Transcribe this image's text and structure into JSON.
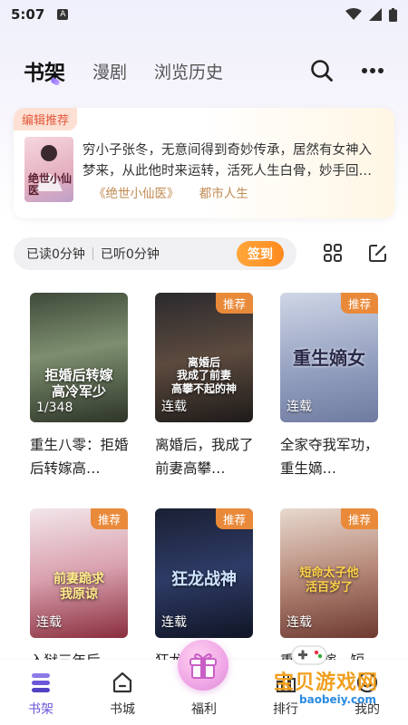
{
  "status": {
    "time": "5:07",
    "notification_icon": "A"
  },
  "header": {
    "tabs": [
      {
        "label": "书架",
        "active": true
      },
      {
        "label": "漫剧",
        "active": false
      },
      {
        "label": "浏览历史",
        "active": false
      }
    ]
  },
  "recommend": {
    "tag": "编辑推荐",
    "cover_text": "绝世小仙医",
    "line1": "穷小子张冬，无意间得到奇妙传承，居然有女神入",
    "line2": "梦来，从此他时来运转，活死人生白骨，妙手回…",
    "book": "《绝世小仙医》",
    "genre": "都市人生"
  },
  "read_bar": {
    "read": "已读0分钟",
    "listened": "已听0分钟",
    "sign": "签到"
  },
  "books": [
    {
      "title": "重生八零：拒婚后转嫁高…",
      "status": "1/348",
      "badge": "",
      "art": "拒婚后转嫁\n高冷军少"
    },
    {
      "title": "离婚后，我成了前妻高攀…",
      "status": "连载",
      "badge": "推荐",
      "art": "离婚后\n我成了前妻\n高攀不起的神"
    },
    {
      "title": "全家夺我军功，重生嫡…",
      "status": "连载",
      "badge": "推荐",
      "art": "重生嫡女"
    },
    {
      "title": "入狱三年后，…",
      "status": "连载",
      "badge": "推荐",
      "art": "前妻跪求\n我原谅"
    },
    {
      "title": "狂龙…",
      "status": "连载",
      "badge": "推荐",
      "art": "狂龙战神"
    },
    {
      "title": "重生…嫁…短",
      "status": "连载",
      "badge": "推荐",
      "art": "短命太子他\n活百岁了"
    }
  ],
  "nav": [
    {
      "label": "书架",
      "icon": "bookshelf-icon",
      "active": true
    },
    {
      "label": "书城",
      "icon": "store-icon",
      "active": false
    },
    {
      "label": "福利",
      "icon": "gift-icon",
      "active": false
    },
    {
      "label": "排行",
      "icon": "rank-icon",
      "active": false
    },
    {
      "label": "我的",
      "icon": "profile-icon",
      "active": false
    }
  ],
  "watermark": {
    "text": "宝贝游戏网",
    "url": "baobeiy.com"
  }
}
